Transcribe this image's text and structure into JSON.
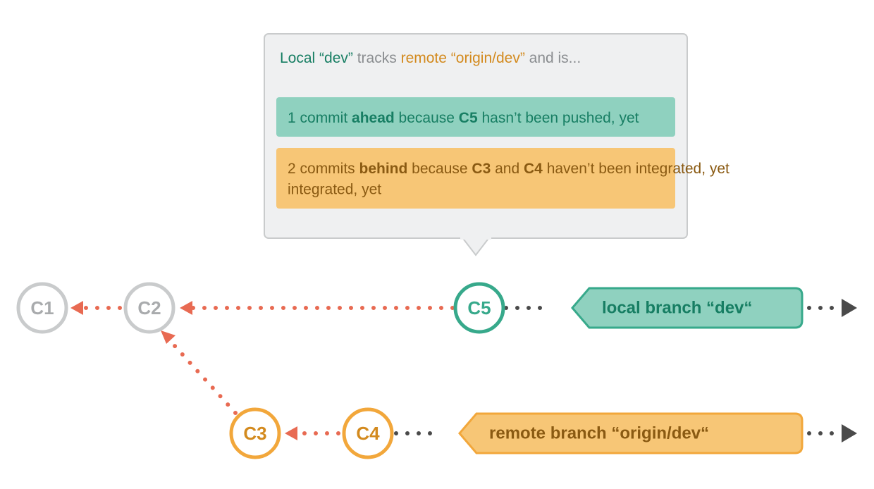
{
  "colors": {
    "gray_stroke": "#c9cbcc",
    "gray_text": "#a9abad",
    "gray_text_dark": "#666a6e",
    "orange": "#f2a73b",
    "orange_fill": "#f7c676",
    "orange_text": "#b77615",
    "green": "#37a98b",
    "green_fill": "#8fd1bf",
    "green_text": "#177e63",
    "red": "#e86a52",
    "panel_bg": "#eff0f1",
    "dark_arrow": "#4a4a4a"
  },
  "commits": {
    "c1": "C1",
    "c2": "C2",
    "c3": "C3",
    "c4": "C4",
    "c5": "C5"
  },
  "branches": {
    "local": "local branch “dev“",
    "remote": "remote branch “origin/dev“"
  },
  "tooltip": {
    "header": {
      "p1": "Local “dev”",
      "p2": " tracks ",
      "p3": "remote “origin/dev”",
      "p4": " and is..."
    },
    "ahead": {
      "p1": "1 commit ",
      "p2": "ahead",
      "p3": " because ",
      "p4": "C5",
      "p5": " hasn’t been pushed, yet"
    },
    "behind": {
      "p1": "2 commits ",
      "p2": "behind",
      "p3": " because ",
      "p4": "C3",
      "p5": " and ",
      "p6": "C4",
      "p7": " haven’t been integrated, yet"
    }
  },
  "chart_data": {
    "type": "diagram",
    "title": "Git tracking branch ahead/behind",
    "nodes": [
      {
        "id": "C1",
        "kind": "commit",
        "color": "gray",
        "row": 0
      },
      {
        "id": "C2",
        "kind": "commit",
        "color": "gray",
        "row": 0
      },
      {
        "id": "C5",
        "kind": "commit",
        "color": "green",
        "row": 0
      },
      {
        "id": "C3",
        "kind": "commit",
        "color": "orange",
        "row": 1
      },
      {
        "id": "C4",
        "kind": "commit",
        "color": "orange",
        "row": 1
      }
    ],
    "edges": [
      {
        "from": "C2",
        "to": "C1",
        "style": "dotted-red"
      },
      {
        "from": "C5",
        "to": "C2",
        "style": "dotted-red"
      },
      {
        "from": "C3",
        "to": "C2",
        "style": "dotted-red"
      },
      {
        "from": "C4",
        "to": "C3",
        "style": "dotted-red"
      },
      {
        "from": "local-branch-dev",
        "to": "C5",
        "style": "dotted-black"
      },
      {
        "from": "remote-branch-origin-dev",
        "to": "C4",
        "style": "dotted-black"
      }
    ],
    "branch_pointers": [
      {
        "name": "local branch “dev“",
        "points_to": "C5",
        "color": "green"
      },
      {
        "name": "remote branch “origin/dev“",
        "points_to": "C4",
        "color": "orange"
      }
    ],
    "status": {
      "tracking": {
        "local": "dev",
        "remote": "origin/dev"
      },
      "ahead": {
        "count": 1,
        "commits": [
          "C5"
        ]
      },
      "behind": {
        "count": 2,
        "commits": [
          "C3",
          "C4"
        ]
      }
    }
  }
}
